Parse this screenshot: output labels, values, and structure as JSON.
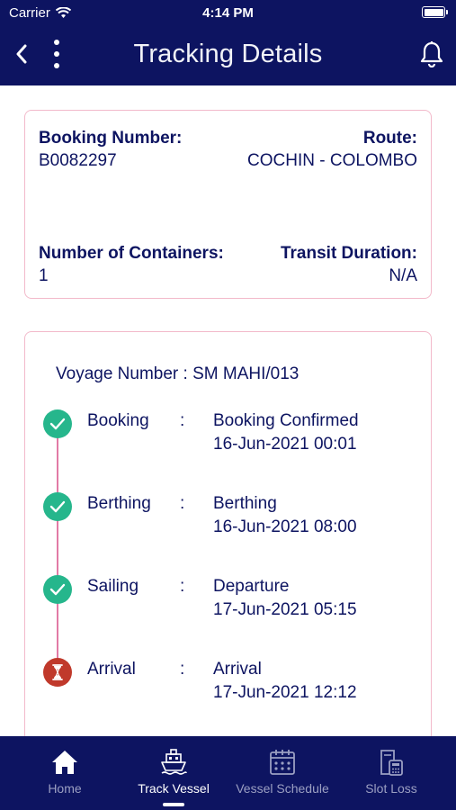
{
  "status_bar": {
    "carrier": "Carrier",
    "time": "4:14 PM"
  },
  "header": {
    "title": "Tracking Details"
  },
  "booking_card": {
    "booking_number_label": "Booking Number:",
    "booking_number": "B0082297",
    "route_label": "Route:",
    "route": "COCHIN - COLOMBO",
    "containers_label": "Number of Containers:",
    "containers": "1",
    "transit_label": "Transit Duration:",
    "transit": "N/A"
  },
  "voyage_card": {
    "voyage": "Voyage Number : SM MAHI/013",
    "steps": [
      {
        "label": "Booking",
        "colon": ":",
        "status": "Booking Confirmed",
        "time": "16-Jun-2021 00:01",
        "state": "done"
      },
      {
        "label": "Berthing",
        "colon": ":",
        "status": "Berthing",
        "time": "16-Jun-2021 08:00",
        "state": "done"
      },
      {
        "label": "Sailing",
        "colon": ":",
        "status": "Departure",
        "time": "17-Jun-2021 05:15",
        "state": "done"
      },
      {
        "label": "Arrival",
        "colon": ":",
        "status": "Arrival",
        "time": "17-Jun-2021 12:12",
        "state": "pending"
      }
    ]
  },
  "tabs": [
    {
      "label": "Home",
      "icon": "home-icon",
      "active": false
    },
    {
      "label": "Track Vessel",
      "icon": "ship-icon",
      "active": true
    },
    {
      "label": "Vessel Schedule",
      "icon": "calendar-icon",
      "active": false
    },
    {
      "label": "Slot Loss",
      "icon": "calculator-icon",
      "active": false
    }
  ],
  "colors": {
    "primary": "#0d1461",
    "success": "#26b68c",
    "pending": "#c0392b",
    "accent": "#e27aa6"
  }
}
